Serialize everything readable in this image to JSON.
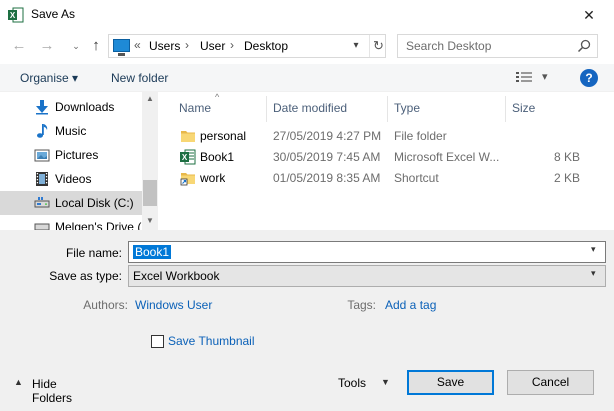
{
  "window": {
    "title": "Save As",
    "app_icon": "excel-icon",
    "close_glyph": "✕"
  },
  "navigation": {
    "back_glyph": "←",
    "forward_glyph": "→",
    "up_glyph": "↑",
    "recent_glyph": "⌄"
  },
  "address": {
    "overflow": "«",
    "crumbs": [
      "Users",
      "User",
      "Desktop"
    ],
    "separator": "›"
  },
  "search": {
    "placeholder": "Search Desktop"
  },
  "toolbar": {
    "organise_label": "Organise ▾",
    "new_folder_label": "New folder",
    "help_label": "?"
  },
  "nav_pane": {
    "items": [
      {
        "label": "Downloads",
        "icon": "download-arrow-icon"
      },
      {
        "label": "Music",
        "icon": "music-note-icon"
      },
      {
        "label": "Pictures",
        "icon": "pictures-icon"
      },
      {
        "label": "Videos",
        "icon": "video-film-icon"
      },
      {
        "label": "Local Disk (C:)",
        "icon": "drive-icon",
        "selected": true
      },
      {
        "label": "Melgen's Drive (",
        "icon": "network-drive-icon"
      }
    ]
  },
  "file_list": {
    "columns": [
      "Name",
      "Date modified",
      "Type",
      "Size"
    ],
    "rows": [
      {
        "name": "personal",
        "date": "27/05/2019 4:27 PM",
        "type": "File folder",
        "size": "",
        "icon": "folder-icon"
      },
      {
        "name": "Book1",
        "date": "30/05/2019 7:45 AM",
        "type": "Microsoft Excel W...",
        "size": "8 KB",
        "icon": "excel-file-icon"
      },
      {
        "name": "work",
        "date": "01/05/2019 8:35 AM",
        "type": "Shortcut",
        "size": "2 KB",
        "icon": "folder-shortcut-icon"
      }
    ]
  },
  "form": {
    "filename_label": "File name:",
    "filename_value": "Book1",
    "savetype_label": "Save as type:",
    "savetype_value": "Excel Workbook",
    "authors_label": "Authors:",
    "authors_value": "Windows User",
    "tags_label": "Tags:",
    "tags_value": "Add a tag",
    "thumbnail_label": "Save Thumbnail"
  },
  "footer": {
    "hide_folders_label": "Hide Folders",
    "tools_label": "Tools",
    "save_label": "Save",
    "cancel_label": "Cancel"
  },
  "colors": {
    "accent": "#0078d7",
    "link": "#0b61b8",
    "excel_green": "#1d6f42",
    "folder_yellow": "#f8d775"
  }
}
